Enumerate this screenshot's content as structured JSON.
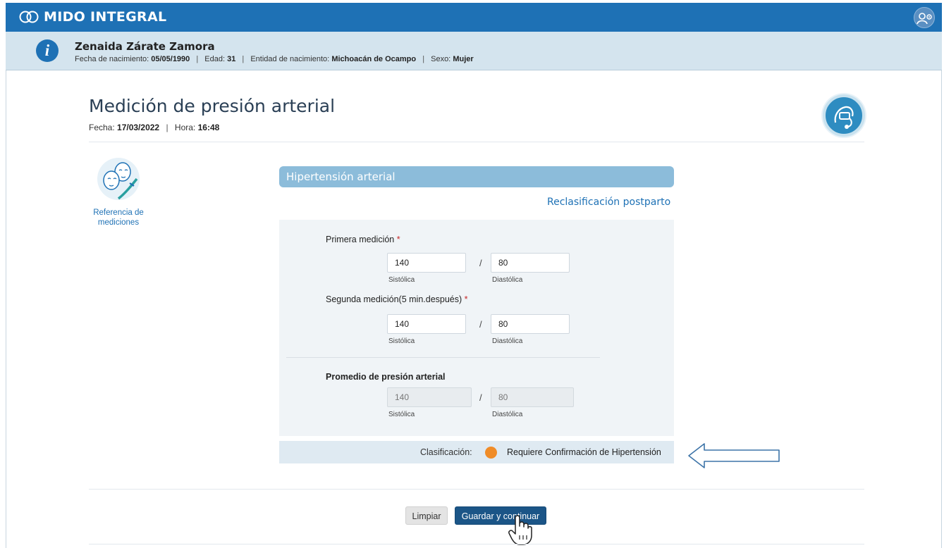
{
  "app": {
    "title": "MIDO INTEGRAL"
  },
  "patient": {
    "name": "Zenaida Zárate Zamora",
    "dob_label": "Fecha de nacimiento:",
    "dob": "05/05/1990",
    "age_label": "Edad:",
    "age": "31",
    "birth_state_label": "Entidad de nacimiento:",
    "birth_state": "Michoacán de Ocampo",
    "sex_label": "Sexo:",
    "sex": "Mujer"
  },
  "page": {
    "title": "Medición de presión arterial",
    "date_label": "Fecha:",
    "date": "17/03/2022",
    "time_label": "Hora:",
    "time": "16:48"
  },
  "reference": {
    "label_line1": "Referencia de",
    "label_line2": "mediciones"
  },
  "section": {
    "header": "Hipertensión arterial",
    "reclass_link": "Reclasificación postparto"
  },
  "form": {
    "first_label": "Primera medición",
    "second_label": "Segunda medición(5 min.después)",
    "required_mark": "*",
    "average_label": "Promedio de presión arterial",
    "systolic_label": "Sistólica",
    "diastolic_label": "Diastólica",
    "slash": "/",
    "first": {
      "systolic": "140",
      "diastolic": "80"
    },
    "second": {
      "systolic": "140",
      "diastolic": "80"
    },
    "average": {
      "systolic": "140",
      "diastolic": "80"
    }
  },
  "classification": {
    "label": "Clasificación:",
    "value": "Requiere Confirmación de Hipertensión",
    "color": "#f08c28"
  },
  "buttons": {
    "clear": "Limpiar",
    "save": "Guardar y continuar"
  },
  "colors": {
    "brand": "#1e71b5",
    "primary_button": "#1b5587",
    "section_header": "#8cbcda"
  }
}
